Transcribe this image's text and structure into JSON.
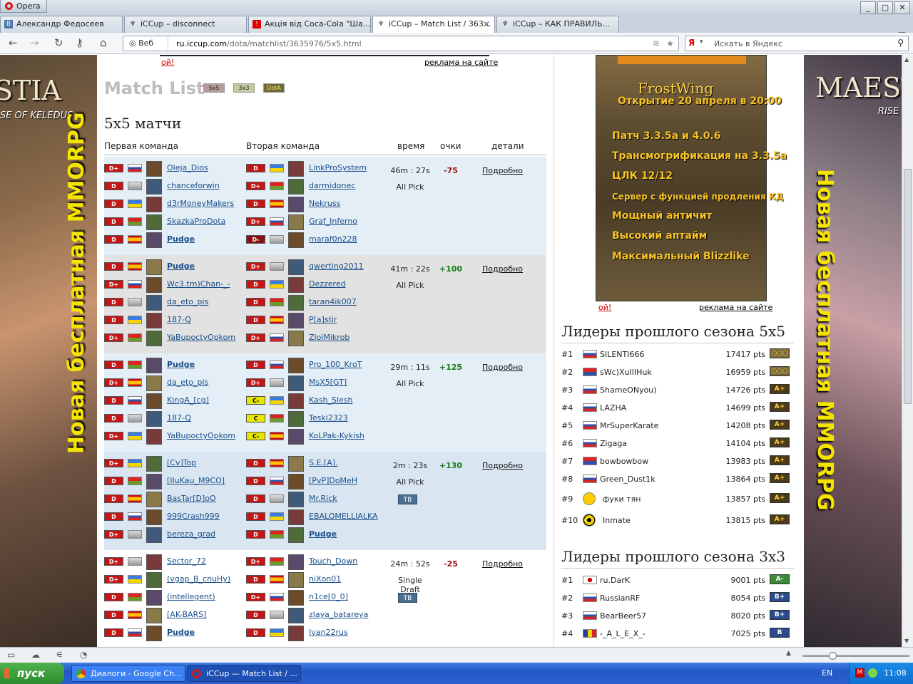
{
  "window": {
    "app_button": "Opera"
  },
  "tabs": [
    {
      "label": "Александр Федосеев",
      "icon": "vk-icon"
    },
    {
      "label": "iCCup – disconnect",
      "icon": "iccup-icon"
    },
    {
      "label": "Акція від Coca-Cola \"Ша...",
      "icon": "coca-cola-icon"
    },
    {
      "label": "iCCup – Match List / 363...",
      "icon": "iccup-icon"
    },
    {
      "label": "iCCup – КАК ПРАВИЛЬ...",
      "icon": "iccup-icon"
    }
  ],
  "nav": {
    "web_label": "Веб",
    "url_domain": "ru.iccup.com",
    "url_path": "/dota/matchlist/3635976/5x5.html",
    "search_placeholder": "Искать в Яндекс",
    "search_engine": "Я"
  },
  "banners": {
    "left_logo": "STIA",
    "left_sub": "SE OF KELEDUS",
    "left_vertical": "Новая бесплатная MMORPG",
    "right_logo": "MAEST",
    "right_sub": "RISE",
    "right_vertical": "Новая бесплатная MMORPG"
  },
  "top_ad": {
    "oi": "ой!",
    "ads_link": "реклама на сайте"
  },
  "page": {
    "title": "Match List",
    "icons": [
      "5x5",
      "3x3",
      "DotA"
    ],
    "subtitle": "5x5 матчи",
    "col_team1": "Первая команда",
    "col_team2": "Вторая команда",
    "col_time": "время",
    "col_points": "очки",
    "col_details": "детали"
  },
  "matches": [
    {
      "time": "46m : 27s",
      "mode": "All Pick",
      "points": "-75",
      "details": "Подробно",
      "tv": "",
      "team1": [
        {
          "name": "Oleja_Dios",
          "rank": "D+",
          "bold": false
        },
        {
          "name": "chanceforwin",
          "rank": "D",
          "bold": false
        },
        {
          "name": "d3rMoneyMakers",
          "rank": "D",
          "bold": false
        },
        {
          "name": "SkazkaProDota",
          "rank": "D",
          "bold": false
        },
        {
          "name": "Pudge",
          "rank": "D",
          "bold": true
        }
      ],
      "team2": [
        {
          "name": "LinkProSystem",
          "rank": "D",
          "bold": false
        },
        {
          "name": "darmidonec",
          "rank": "D+",
          "bold": false
        },
        {
          "name": "Nekruss",
          "rank": "D",
          "bold": false
        },
        {
          "name": "Graf_Inferno",
          "rank": "D+",
          "bold": false
        },
        {
          "name": "maraf0n228",
          "rank": "D-",
          "bold": false
        }
      ]
    },
    {
      "time": "41m : 22s",
      "mode": "All Pick",
      "points": "+100",
      "details": "Подробно",
      "tv": "",
      "team1": [
        {
          "name": "Pudge",
          "rank": "D",
          "bold": true
        },
        {
          "name": "Wc3.tm)Chan-_-",
          "rank": "D+",
          "bold": false
        },
        {
          "name": "da_eto_pis",
          "rank": "D",
          "bold": false
        },
        {
          "name": "187-Q",
          "rank": "D",
          "bold": false
        },
        {
          "name": "YaBupoctyOpkom",
          "rank": "D+",
          "bold": false
        }
      ],
      "team2": [
        {
          "name": "qwerting2011",
          "rank": "D+",
          "bold": false
        },
        {
          "name": "Dezzered",
          "rank": "D",
          "bold": false
        },
        {
          "name": "taran4ik007",
          "rank": "D",
          "bold": false
        },
        {
          "name": "P[a]stir",
          "rank": "D",
          "bold": false
        },
        {
          "name": "ZloiMikrob",
          "rank": "D+",
          "bold": false
        }
      ]
    },
    {
      "time": "29m : 11s",
      "mode": "All Pick",
      "points": "+125",
      "details": "Подробно",
      "tv": "",
      "team1": [
        {
          "name": "Pudge",
          "rank": "D",
          "bold": true
        },
        {
          "name": "da_eto_pis",
          "rank": "D+",
          "bold": false
        },
        {
          "name": "KingA_[cg]",
          "rank": "D",
          "bold": false
        },
        {
          "name": "187-Q",
          "rank": "D",
          "bold": false
        },
        {
          "name": "YaBupoctyOpkom",
          "rank": "D+",
          "bold": false
        }
      ],
      "team2": [
        {
          "name": "Pro_100_KroT",
          "rank": "D",
          "bold": false
        },
        {
          "name": "MsX5[GT]",
          "rank": "D+",
          "bold": false
        },
        {
          "name": "Kash_Slesh",
          "rank": "C-",
          "bold": false
        },
        {
          "name": "Teski2323",
          "rank": "C",
          "bold": false
        },
        {
          "name": "KoLPak-Kykish",
          "rank": "C-",
          "bold": false
        }
      ]
    },
    {
      "time": "2m : 23s",
      "mode": "All Pick",
      "points": "+130",
      "details": "Подробно",
      "tv": "ТВ",
      "team1": [
        {
          "name": "[Cv]Top",
          "rank": "D+",
          "bold": false
        },
        {
          "name": "[IIuKau_M9CO]",
          "rank": "D",
          "bold": false
        },
        {
          "name": "BasTar[D]oO",
          "rank": "D",
          "bold": false
        },
        {
          "name": "999Crash999",
          "rank": "D",
          "bold": false
        },
        {
          "name": "bereza_grad",
          "rank": "D+",
          "bold": false
        }
      ],
      "team2": [
        {
          "name": "S.E.[A].",
          "rank": "D",
          "bold": false
        },
        {
          "name": "[PvP]DoMeH",
          "rank": "D",
          "bold": false
        },
        {
          "name": "Mr.Rick",
          "rank": "D",
          "bold": false
        },
        {
          "name": "EBALOMELLIALKA",
          "rank": "D",
          "bold": false
        },
        {
          "name": "Pudge",
          "rank": "D",
          "bold": true
        }
      ]
    },
    {
      "time": "24m : 52s",
      "mode": "Single Draft",
      "points": "-25",
      "details": "Подробно",
      "tv": "ТВ",
      "team1": [
        {
          "name": "Sector_72",
          "rank": "D+",
          "bold": false
        },
        {
          "name": "(vgap_B_cnuHy)",
          "rank": "D+",
          "bold": false
        },
        {
          "name": "(intellegent)",
          "rank": "D",
          "bold": false
        },
        {
          "name": "[AK-BARS]",
          "rank": "D",
          "bold": false
        },
        {
          "name": "Pudge",
          "rank": "D",
          "bold": true
        }
      ],
      "team2": [
        {
          "name": "Touch_Down",
          "rank": "D+",
          "bold": false
        },
        {
          "name": "niXon01",
          "rank": "D",
          "bold": false
        },
        {
          "name": "n1ce[0_0]",
          "rank": "D+",
          "bold": false
        },
        {
          "name": "zlaya_batareya",
          "rank": "D",
          "bold": false
        },
        {
          "name": "Ivan22rus",
          "rank": "D",
          "bold": false
        }
      ]
    }
  ],
  "side_ad": {
    "lines": [
      "FrostWing",
      "Открытие 20 апреля в 20:00",
      "Патч 3.3.5a и 4.0.6",
      "Трансмогрификация на 3.3.5a",
      "ЦЛК 12/12",
      "Сервер с функцией продления КД",
      "Мощный античит",
      "Высокий аптайм",
      "Максимальный Blizzlike"
    ],
    "oi": "ой!",
    "ads_link": "реклама на сайте"
  },
  "leaders_5x5": {
    "title": "Лидеры прошлого сезона 5x5",
    "rows": [
      {
        "num": "#1",
        "name": "SILENTI666",
        "pts": "17417 pts",
        "badge": "○○○"
      },
      {
        "num": "#2",
        "name": "sWc)XuIIIHuk",
        "pts": "16959 pts",
        "badge": "○○○"
      },
      {
        "num": "#3",
        "name": "ShameONyou)",
        "pts": "14726 pts",
        "badge": "A+"
      },
      {
        "num": "#4",
        "name": "LAZHA",
        "pts": "14699 pts",
        "badge": "A+"
      },
      {
        "num": "#5",
        "name": "MrSuperKarate",
        "pts": "14208 pts",
        "badge": "A+"
      },
      {
        "num": "#6",
        "name": "Zigaga",
        "pts": "14104 pts",
        "badge": "A+"
      },
      {
        "num": "#7",
        "name": "bowbowbow",
        "pts": "13983 pts",
        "badge": "A+"
      },
      {
        "num": "#8",
        "name": "Green_Dust1k",
        "pts": "13864 pts",
        "badge": "A+"
      },
      {
        "num": "#9",
        "name": "фуки тян",
        "pts": "13857 pts",
        "badge": "A+"
      },
      {
        "num": "#10",
        "name": "Inmate",
        "pts": "13815 pts",
        "badge": "A+"
      }
    ]
  },
  "leaders_3x3": {
    "title": "Лидеры прошлого сезона 3x3",
    "rows": [
      {
        "num": "#1",
        "name": "ru.DarK",
        "pts": "9001 pts",
        "badge": "A-"
      },
      {
        "num": "#2",
        "name": "RussianRF",
        "pts": "8054 pts",
        "badge": "B+"
      },
      {
        "num": "#3",
        "name": "BearBeer57",
        "pts": "8020 pts",
        "badge": "B+"
      },
      {
        "num": "#4",
        "name": "-_A_L_E_X_-",
        "pts": "7025 pts",
        "badge": "B"
      }
    ]
  },
  "taskbar": {
    "start": "пуск",
    "tasks": [
      "Диалоги - Google Ch...",
      "iCCup — Match List / ..."
    ],
    "lang": "EN",
    "clock": "11:08"
  },
  "colors": {
    "link": "#1a4f8a",
    "negative": "#a01010",
    "positive": "#1a7a1a",
    "rank_red": "#c31616",
    "rank_dark": "#333333",
    "rank_c": "#e6e600"
  }
}
